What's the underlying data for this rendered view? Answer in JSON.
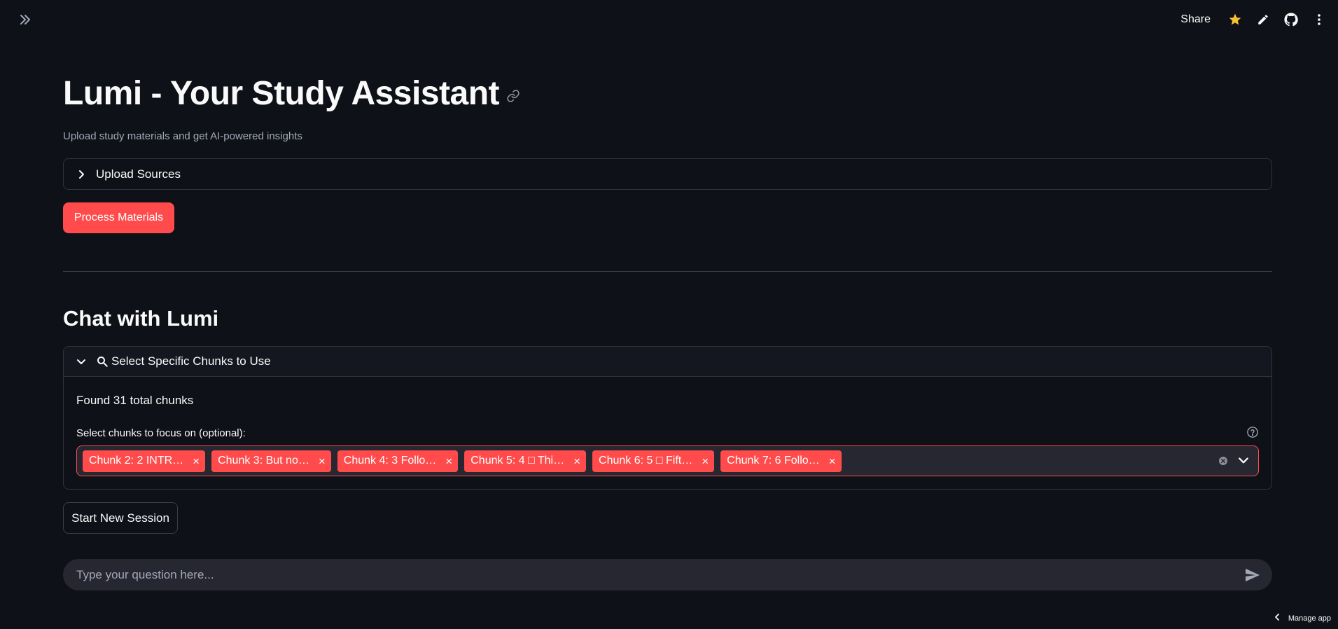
{
  "toolbar": {
    "share_label": "Share",
    "star_color": "#f7c137",
    "icons": [
      "double-chevron-right-icon",
      "star-icon",
      "pencil-icon",
      "github-icon",
      "kebab-menu-icon"
    ]
  },
  "header": {
    "title": "Lumi - Your Study Assistant",
    "subtitle": "Upload study materials and get AI-powered insights"
  },
  "upload_expander": {
    "label": "Upload Sources",
    "expanded": false
  },
  "process_button": {
    "label": "Process Materials",
    "color": "#ff4b4b"
  },
  "chat_section": {
    "title": "Chat with Lumi"
  },
  "chunks_expander": {
    "label": "Select Specific Chunks to Use",
    "expanded": true,
    "found_text": "Found 31 total chunks",
    "select_label": "Select chunks to focus on (optional):",
    "selected_chunks": [
      "Chunk 2: 2 INTR…",
      "Chunk 3: But no…",
      "Chunk 4: 3 Follo…",
      "Chunk 5: 4 □ Thi…",
      "Chunk 6: 5 □ Fift…",
      "Chunk 7: 6 Follo…"
    ]
  },
  "new_session_button": {
    "label": "Start New Session"
  },
  "chat_input": {
    "placeholder": "Type your question here..."
  },
  "footer": {
    "manage_app_label": "Manage app"
  },
  "theme": {
    "background": "#0e1117",
    "accent": "#ff4b4b",
    "input_bg": "#262730"
  }
}
